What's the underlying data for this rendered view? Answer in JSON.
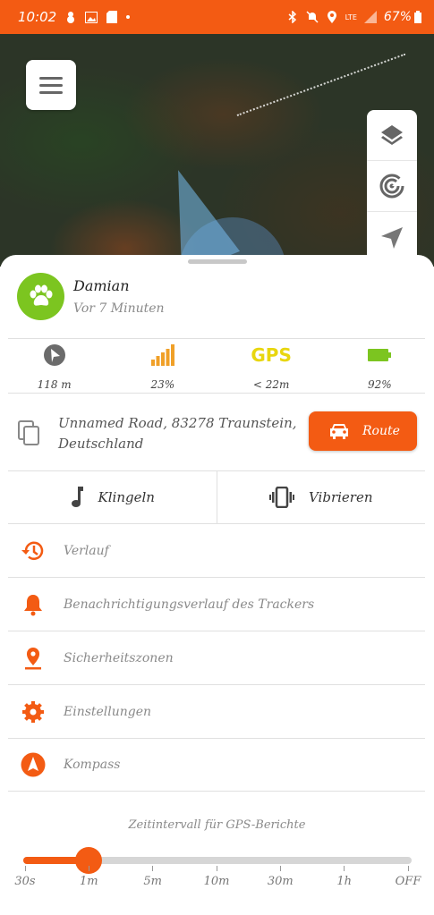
{
  "status_bar": {
    "time": "10:02",
    "network": "LTE",
    "battery": "67%",
    "left_icons": [
      "snowman-icon",
      "image-icon",
      "sd-card-icon"
    ],
    "right_icons": [
      "bluetooth-icon",
      "mute-icon",
      "location-icon",
      "signal-icon",
      "battery-icon"
    ]
  },
  "map": {
    "menu_icon": "hamburger-icon",
    "tools": [
      "layers-icon",
      "radar-icon",
      "navigation-arrow-icon"
    ]
  },
  "tracker": {
    "name": "Damian",
    "last_seen": "Vor 7 Minuten",
    "avatar_icon": "paw-icon",
    "avatar_color": "#7cc520"
  },
  "stats": [
    {
      "icon": "play-direction-icon",
      "value": "118 m"
    },
    {
      "icon": "signal-bars-icon",
      "value": "23%"
    },
    {
      "icon": "gps-label",
      "label": "GPS",
      "value": "< 22m"
    },
    {
      "icon": "battery-icon",
      "value": "92%"
    }
  ],
  "address": {
    "text": "Unnamed Road, 83278 Traunstein, Deutschland",
    "route_label": "Route"
  },
  "actions": {
    "ring_label": "Klingeln",
    "vibrate_label": "Vibrieren"
  },
  "menu": [
    {
      "id": "history",
      "icon": "history-icon",
      "label": "Verlauf"
    },
    {
      "id": "notification-history",
      "icon": "bell-icon",
      "label": "Benachrichtigungsverlauf des Trackers"
    },
    {
      "id": "safety-zones",
      "icon": "map-pin-icon",
      "label": "Sicherheitszonen"
    },
    {
      "id": "settings",
      "icon": "gear-icon",
      "label": "Einstellungen"
    },
    {
      "id": "compass",
      "icon": "compass-icon",
      "label": "Kompass"
    }
  ],
  "gps_interval": {
    "title": "Zeitintervall für GPS-Berichte",
    "options": [
      "30s",
      "1m",
      "5m",
      "10m",
      "30m",
      "1h",
      "OFF"
    ],
    "selected": "1m"
  },
  "colors": {
    "accent": "#f35b13",
    "gps": "#e8d60e",
    "battery": "#7cc520",
    "signal": "#f0a028"
  }
}
